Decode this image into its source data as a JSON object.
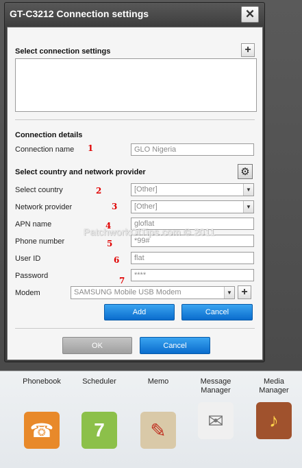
{
  "window": {
    "title": "GT-C3212 Connection settings",
    "close_label": "✕"
  },
  "connection_settings": {
    "heading": "Select connection settings",
    "add_label": "+"
  },
  "connection_details": {
    "heading": "Connection details",
    "name_label": "Connection name",
    "name_value": "GLO Nigeria"
  },
  "provider_section": {
    "heading": "Select country and network provider",
    "gear_icon": "⚙",
    "country_label": "Select country",
    "country_value": "[Other]",
    "provider_label": "Network provider",
    "provider_value": "[Other]",
    "apn_label": "APN name",
    "apn_value": "gloflat",
    "phone_label": "Phone number",
    "phone_value": "*99#",
    "userid_label": "User ID",
    "userid_value": "flat",
    "password_label": "Password",
    "password_value": "****",
    "modem_label": "Modem",
    "modem_value": "SAMSUNG Mobile USB Modem",
    "modem_add_label": "+",
    "dropdown_arrow": "▼"
  },
  "buttons": {
    "add": "Add",
    "cancel_inner": "Cancel",
    "ok": "OK",
    "cancel": "Cancel"
  },
  "annotations": [
    "1",
    "2",
    "3",
    "4",
    "5",
    "6",
    "7"
  ],
  "watermark": "PatchworkOfTips.com © 2011",
  "launcher": [
    {
      "label": "Phonebook",
      "icon": "phonebook-icon",
      "glyph": "☎",
      "color": "#e8892a"
    },
    {
      "label": "Scheduler",
      "icon": "scheduler-icon",
      "glyph": "7",
      "color": "#8cc04a"
    },
    {
      "label": "Memo",
      "icon": "memo-icon",
      "glyph": "✎",
      "color": "#d9c9a8"
    },
    {
      "label": "Message Manager",
      "icon": "message-manager-icon",
      "glyph": "✉",
      "color": "#f0f0f0"
    },
    {
      "label": "Media Manager",
      "icon": "media-manager-icon",
      "glyph": "♪",
      "color": "#a0522d"
    }
  ],
  "colors": {
    "accent": "#1a7ede",
    "dialog_frame": "#3a3a3a",
    "annotation": "#e00000"
  }
}
